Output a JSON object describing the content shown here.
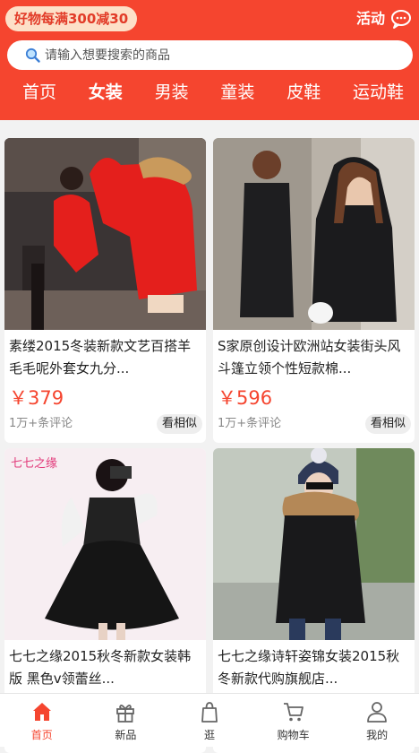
{
  "header": {
    "promo": "好物每满300减30",
    "activity": "活动",
    "search_placeholder": "请输入想要搜索的商品"
  },
  "tabs": [
    "首页",
    "女装",
    "男装",
    "童装",
    "皮鞋",
    "运动鞋"
  ],
  "products": [
    {
      "title": "素缕2015冬装新款文艺百搭羊毛毛呢外套女九分...",
      "price": "￥379",
      "reviews": "1万+条评论",
      "similar": "看相似"
    },
    {
      "title": "S家原创设计欧洲站女装街头风斗篷立领个性短款棉...",
      "price": "￥596",
      "reviews": "1万+条评论",
      "similar": "看相似"
    },
    {
      "title": "七七之缘2015秋冬新款女装韩版 黑色v领蕾丝...",
      "price": "",
      "reviews": "",
      "similar": "",
      "brand_label": "七七之缘"
    },
    {
      "title": "七七之缘诗轩姿锦女装2015秋冬新款代购旗舰店...",
      "price": "",
      "reviews": "",
      "similar": ""
    }
  ],
  "bottom_nav": [
    "首页",
    "新品",
    "逛",
    "购物车",
    "我的"
  ],
  "colors": {
    "accent": "#f5452f",
    "promo_bg": "#fde0c8"
  }
}
